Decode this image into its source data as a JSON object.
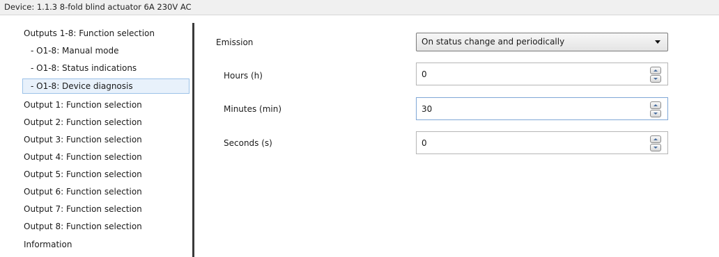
{
  "title": "Device: 1.1.3  8-fold blind  actuator 6A 230V AC",
  "sidebar": {
    "items": [
      {
        "label": "Outputs 1-8: Function selection"
      },
      {
        "label": "- O1-8: Manual mode"
      },
      {
        "label": "- O1-8: Status indications"
      },
      {
        "label": "- O1-8: Device diagnosis",
        "selected": true
      },
      {
        "label": "Output 1: Function selection"
      },
      {
        "label": "Output 2: Function selection"
      },
      {
        "label": "Output 3: Function selection"
      },
      {
        "label": "Output 4: Function selection"
      },
      {
        "label": "Output 5: Function selection"
      },
      {
        "label": "Output 6: Function selection"
      },
      {
        "label": "Output 7: Function selection"
      },
      {
        "label": "Output 8: Function selection"
      },
      {
        "label": "Information"
      }
    ]
  },
  "params": {
    "emission": {
      "label": "Emission",
      "value": "On status change and periodically",
      "icon": "chevron-down-icon"
    },
    "hours": {
      "label": "Hours (h)",
      "value": "0"
    },
    "minutes": {
      "label": "Minutes (min)",
      "value": "30"
    },
    "seconds": {
      "label": "Seconds (s)",
      "value": "0"
    }
  },
  "colors": {
    "selection_bg": "#e8f1fb",
    "selection_border": "#9cc2e8",
    "divider": "#3a3a3a"
  }
}
